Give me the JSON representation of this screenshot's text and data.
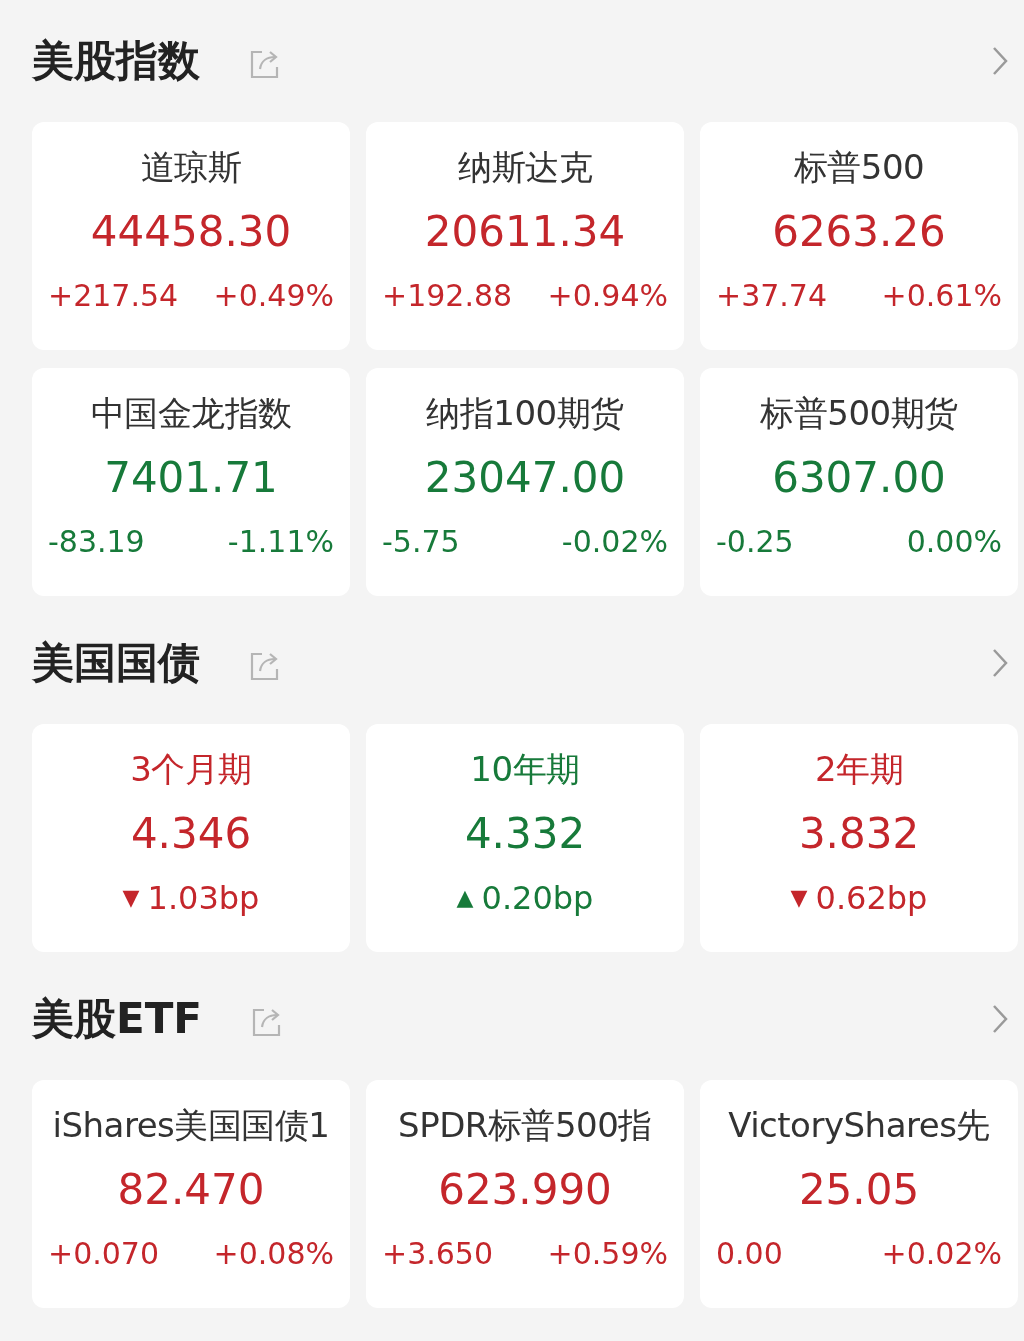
{
  "sections": [
    {
      "title": "美股指数",
      "cards": [
        {
          "kind": "quote",
          "name": "道琼斯",
          "price": "44458.30",
          "change": "+217.54",
          "percent": "+0.49%",
          "color": "#c4262b"
        },
        {
          "kind": "quote",
          "name": "纳斯达克",
          "price": "20611.34",
          "change": "+192.88",
          "percent": "+0.94%",
          "color": "#c4262b"
        },
        {
          "kind": "quote",
          "name": "标普500",
          "price": "6263.26",
          "change": "+37.74",
          "percent": "+0.61%",
          "color": "#c4262b"
        },
        {
          "kind": "quote",
          "name": "中国金龙指数",
          "price": "7401.71",
          "change": "-83.19",
          "percent": "-1.11%",
          "color": "#177a3a"
        },
        {
          "kind": "quote",
          "name": "纳指100期货",
          "price": "23047.00",
          "change": "-5.75",
          "percent": "-0.02%",
          "color": "#177a3a"
        },
        {
          "kind": "quote",
          "name": "标普500期货",
          "price": "6307.00",
          "change": "-0.25",
          "percent": "0.00%",
          "color": "#177a3a"
        }
      ]
    },
    {
      "title": "美国国债",
      "cards": [
        {
          "kind": "bond",
          "name": "3个月期",
          "price": "4.346",
          "arrow": "▼",
          "change": "1.03bp",
          "color": "#c4262b"
        },
        {
          "kind": "bond",
          "name": "10年期",
          "price": "4.332",
          "arrow": "▲",
          "change": "0.20bp",
          "color": "#177a3a"
        },
        {
          "kind": "bond",
          "name": "2年期",
          "price": "3.832",
          "arrow": "▼",
          "change": "0.62bp",
          "color": "#c4262b"
        }
      ]
    },
    {
      "title": "美股ETF",
      "cards": [
        {
          "kind": "quote",
          "name": "iShares美国国债1",
          "price": "82.470",
          "change": "+0.070",
          "percent": "+0.08%",
          "color": "#c4262b"
        },
        {
          "kind": "quote",
          "name": "SPDR标普500指",
          "price": "623.990",
          "change": "+3.650",
          "percent": "+0.59%",
          "color": "#c4262b"
        },
        {
          "kind": "quote",
          "name": "VictoryShares先",
          "price": "25.05",
          "change": "0.00",
          "percent": "+0.02%",
          "color": "#c4262b"
        }
      ]
    }
  ]
}
